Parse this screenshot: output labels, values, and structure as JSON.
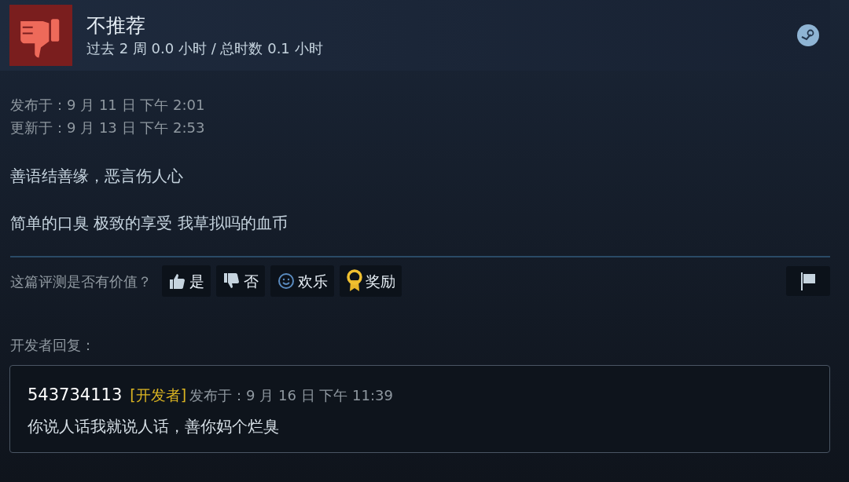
{
  "header": {
    "verdict": "不推荐",
    "hours": "过去 2 周 0.0 小时 / 总时数 0.1 小时"
  },
  "dates": [
    "发布于：9 月 11 日 下午 2:01",
    "更新于：9 月 13 日 下午 2:53"
  ],
  "paragraphs": [
    "善语结善缘，恶言伤人心",
    "简单的口臭 极致的享受 我草拟吗的血币"
  ],
  "helpful": {
    "prompt": "这篇评测是否有价值？",
    "buttons": [
      {
        "kind": "thumbs_up",
        "label": "是"
      },
      {
        "kind": "thumbs_down",
        "label": "否"
      },
      {
        "kind": "smile",
        "label": "欢乐"
      },
      {
        "kind": "award",
        "label": "奖励"
      }
    ]
  },
  "developer_reply": {
    "heading": "开发者回复：",
    "author": "543734113",
    "badge": "[开发者]",
    "posted": "发布于：9 月 16 日 下午 11:39",
    "text": "你说人话我就说人话，善你妈个烂臭"
  }
}
